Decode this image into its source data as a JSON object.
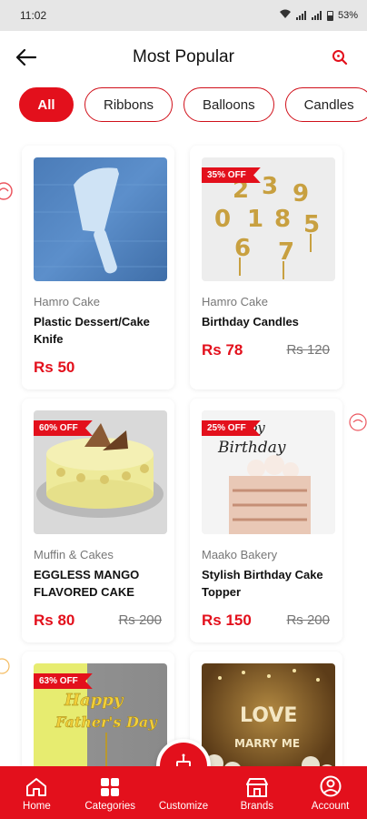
{
  "status_bar": {
    "time": "11:02",
    "battery": "53%"
  },
  "header": {
    "title": "Most Popular"
  },
  "chips": [
    "All",
    "Ribbons",
    "Balloons",
    "Candles"
  ],
  "products": [
    {
      "brand": "Hamro Cake",
      "name": "Plastic Dessert/Cake Knife",
      "price": "Rs 50",
      "old_price": "",
      "discount": ""
    },
    {
      "brand": "Hamro Cake",
      "name": "Birthday Candles",
      "price": "Rs 78",
      "old_price": "Rs 120",
      "discount": "35% OFF"
    },
    {
      "brand": "Muffin & Cakes",
      "name": "EGGLESS MANGO FLAVORED CAKE",
      "price": "Rs 80",
      "old_price": "Rs 200",
      "discount": "60% OFF"
    },
    {
      "brand": "Maako Bakery",
      "name": "Stylish Birthday Cake Topper",
      "price": "Rs 150",
      "old_price": "Rs 200",
      "discount": "25% OFF"
    },
    {
      "brand": "",
      "name": "",
      "price": "",
      "old_price": "",
      "discount": "63% OFF",
      "image_text": [
        "Happy",
        "Father's Day"
      ]
    },
    {
      "brand": "",
      "name": "",
      "price": "",
      "old_price": "",
      "discount": "",
      "image_text": [
        "LOVE",
        "MARRY ME"
      ]
    }
  ],
  "nav": {
    "home": "Home",
    "categories": "Categories",
    "customize": "Customize",
    "brands": "Brands",
    "account": "Account"
  },
  "colors": {
    "accent": "#e3101c",
    "status_bar_bg": "#e6e6e6"
  }
}
